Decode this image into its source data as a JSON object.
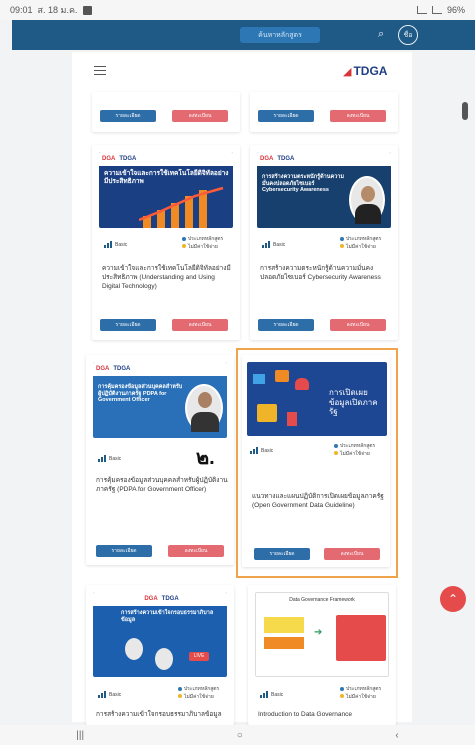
{
  "status_bar": {
    "time": "09:01",
    "date": "ส. 18 ม.ค.",
    "battery": "96%"
  },
  "topbar": {
    "center_label": "ค้นหาหลักสูตร",
    "search_icon": "search-icon",
    "avatar_label": "ชื่อ"
  },
  "header": {
    "logo_text": "TDGA",
    "menu_icon": "hamburger-icon"
  },
  "cards": [
    {
      "dga": "DGA",
      "tdga": "TDGA",
      "thumb_title": "ความเข้าใจและการใช้เทคโนโลยีดิจิทัลอย่างมีประสิทธิภาพ",
      "level": "Basic",
      "meta1": "ประเภทหลักสูตร",
      "meta2": "ไม่มีค่าใช้จ่าย",
      "title": "ความเข้าใจและการใช้เทคโนโลยีดิจิทัลอย่างมีประสิทธิภาพ (Understanding and Using Digital Technology)",
      "btn_detail": "รายละเอียด",
      "btn_register": "ลงทะเบียน"
    },
    {
      "dga": "DGA",
      "tdga": "TDGA",
      "thumb_title": "การสร้างความตระหนักรู้ด้านความมั่นคงปลอดภัยไซเบอร์ Cybersecurity Awareness",
      "level": "Basic",
      "meta1": "ประเภทหลักสูตร",
      "meta2": "ไม่มีค่าใช้จ่าย",
      "title": "การสร้างความตระหนักรู้ด้านความมั่นคงปลอดภัยไซเบอร์ Cybersecurity Awareness",
      "btn_detail": "รายละเอียด",
      "btn_register": "ลงทะเบียน"
    },
    {
      "dga": "DGA",
      "tdga": "TDGA",
      "thumb_title": "การคุ้มครองข้อมูลส่วนบุคคลสำหรับผู้ปฏิบัติงานภาครัฐ PDPA for Government Officer",
      "level": "Basic",
      "meta1": "ประเภทหลักสูตร",
      "meta2": "ไม่มีค่าใช้จ่าย",
      "title": "การคุ้มครองข้อมูลส่วนบุคคลสำหรับผู้ปฏิบัติงานภาครัฐ (PDPA for Government Officer)",
      "btn_detail": "รายละเอียด",
      "btn_register": "ลงทะเบียน",
      "badge": "๒."
    },
    {
      "thumb_title": "การเปิดเผยข้อมูลเปิดภาครัฐ",
      "level": "Basic",
      "meta1": "ประเภทหลักสูตร",
      "meta2": "ไม่มีค่าใช้จ่าย",
      "title": "แนวทางและแผนปฏิบัติการเปิดเผยข้อมูลภาครัฐ (Open Government Data Guideline)",
      "btn_detail": "รายละเอียด",
      "btn_register": "ลงทะเบียน"
    },
    {
      "dga": "DGA",
      "tdga": "TDGA",
      "thumb_title": "การสร้างความเข้าใจกรอบธรรมาภิบาลข้อมูล",
      "level": "Basic",
      "meta1": "ประเภทหลักสูตร",
      "meta2": "ไม่มีค่าใช้จ่าย",
      "title": "การสร้างความเข้าใจกรอบธรรมาภิบาลข้อมูล"
    },
    {
      "thumb_title": "Data Governance Framework",
      "level": "Basic",
      "meta1": "ประเภทหลักสูตร",
      "meta2": "ไม่มีค่าใช้จ่าย",
      "title": "Introduction to Data Governance"
    }
  ],
  "top_partial": {
    "btn_detail": "รายละเอียด",
    "btn_register": "ลงทะเบียน"
  },
  "nav": {
    "recent": "|||",
    "home": "○",
    "back": "‹"
  },
  "colors": {
    "brand_blue": "#1f5a86",
    "accent_red": "#e46a72",
    "highlight": "#f0a449"
  }
}
